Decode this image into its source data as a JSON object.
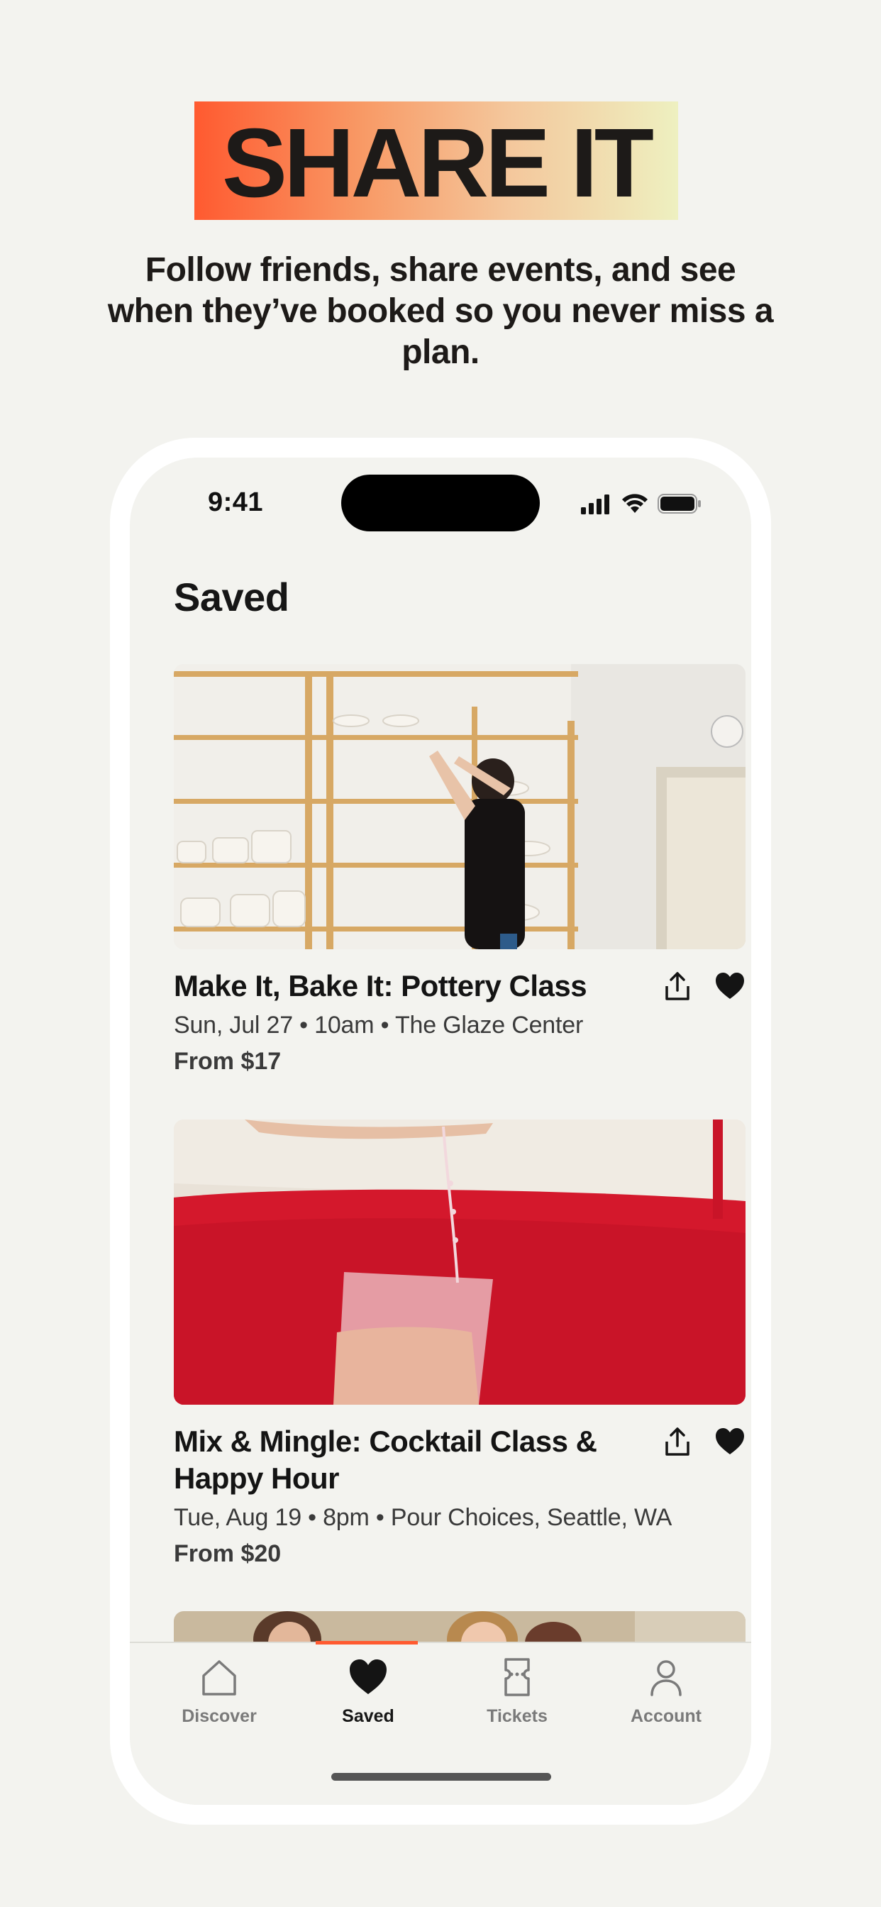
{
  "hero": {
    "title": "SHARE IT",
    "subtitle": "Follow friends, share events, and see when they’ve booked so you never miss a plan."
  },
  "status_bar": {
    "time": "9:41"
  },
  "page": {
    "title": "Saved"
  },
  "cards": [
    {
      "title": "Make It, Bake It: Pottery Class",
      "meta": "Sun, Jul 27 • 10am • The Glaze Center",
      "price": "From $17",
      "image": "pottery-studio-photo"
    },
    {
      "title": "Mix & Mingle: Cocktail Class & Happy Hour",
      "meta": "Tue, Aug 19 • 8pm • Pour Choices, Seattle, WA",
      "price": "From $20",
      "image": "cocktail-pour-photo"
    },
    {
      "image": "friends-group-photo"
    }
  ],
  "tabs": [
    {
      "label": "Discover",
      "icon": "home-icon"
    },
    {
      "label": "Saved",
      "icon": "heart-icon",
      "active": true
    },
    {
      "label": "Tickets",
      "icon": "ticket-icon"
    },
    {
      "label": "Account",
      "icon": "person-icon"
    }
  ],
  "colors": {
    "accent": "#ff5a30",
    "background": "#f3f3ef",
    "text": "#1a1818"
  }
}
